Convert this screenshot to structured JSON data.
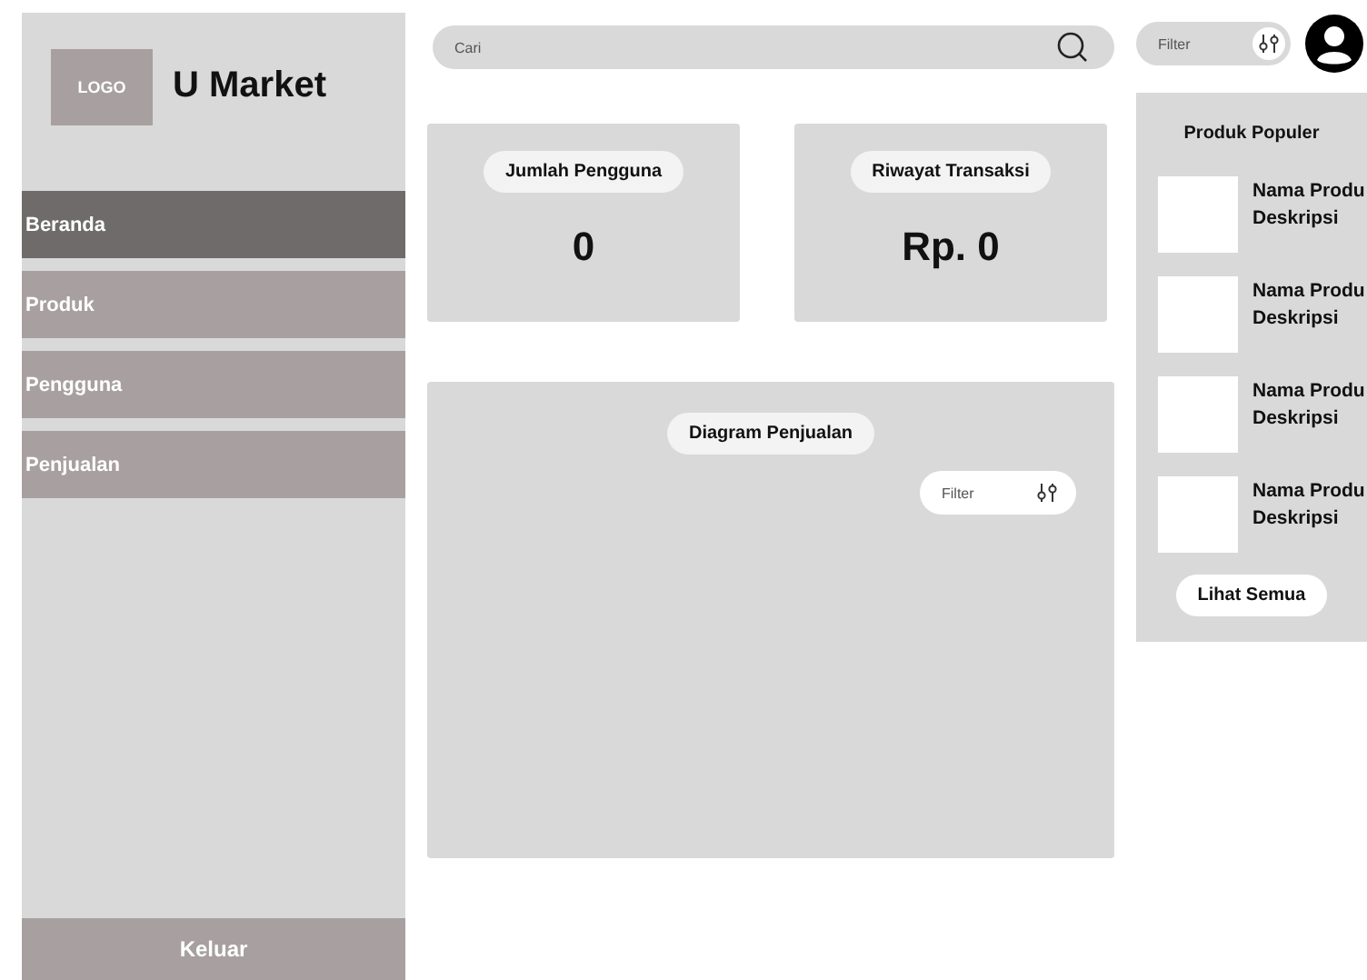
{
  "sidebar": {
    "logo": "LOGO",
    "app_name": "U Market",
    "items": [
      {
        "label": "Beranda",
        "selected": true
      },
      {
        "label": "Produk",
        "selected": false
      },
      {
        "label": "Pengguna",
        "selected": false
      },
      {
        "label": "Penjualan",
        "selected": false
      }
    ],
    "logout": "Keluar"
  },
  "search": {
    "placeholder": "Cari"
  },
  "filter": {
    "placeholder": "Filter"
  },
  "stats": [
    {
      "title": "Jumlah Pengguna",
      "value": "0"
    },
    {
      "title": "Riwayat Transaksi",
      "value": "Rp. 0"
    }
  ],
  "sales_chart": {
    "title": "Diagram Penjualan",
    "filter_placeholder": "Filter"
  },
  "popular": {
    "title": "Produk Populer",
    "products": [
      {
        "name": "Nama Produ",
        "description": "Deskripsi"
      },
      {
        "name": "Nama Produ",
        "description": "Deskripsi"
      },
      {
        "name": "Nama Produ",
        "description": "Deskripsi"
      },
      {
        "name": "Nama Produ",
        "description": "Deskripsi"
      }
    ],
    "see_all": "Lihat Semua"
  }
}
